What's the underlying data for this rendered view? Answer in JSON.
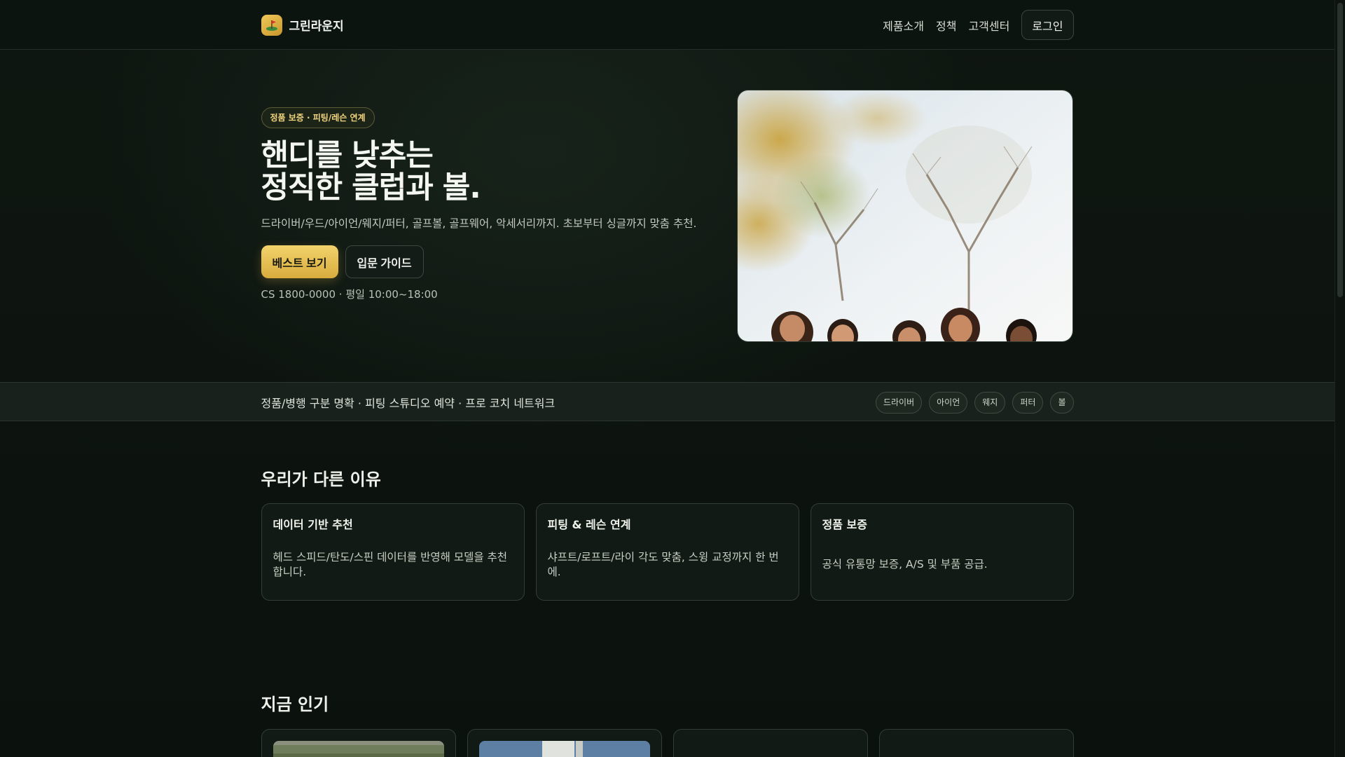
{
  "header": {
    "brand": "그린라운지",
    "nav": [
      "제품소개",
      "정책",
      "고객센터"
    ],
    "login": "로그인"
  },
  "hero": {
    "badge": "정품 보증 · 피팅/레슨 연계",
    "title_line1": "핸디를 낮추는",
    "title_line2": "정직한 클럽과 볼.",
    "description": "드라이버/우드/아이언/웨지/퍼터, 골프볼, 골프웨어, 악세서리까지. 초보부터 싱글까지 맞춤 추천.",
    "primary_cta": "베스트 보기",
    "secondary_cta": "입문 가이드",
    "cs": "CS 1800-0000 · 평일 10:00~18:00"
  },
  "strip": {
    "text": "정품/병행 구분 명확 · 피팅 스튜디오 예약 · 프로 코치 네트워크",
    "tags": [
      "드라이버",
      "아이언",
      "웨지",
      "퍼터",
      "볼"
    ]
  },
  "why": {
    "title": "우리가 다른 이유",
    "cards": [
      {
        "title": "데이터 기반 추천",
        "body": "헤드 스피드/탄도/스핀 데이터를 반영해 모델을 추천합니다."
      },
      {
        "title": "피팅 & 레슨 연계",
        "body": "샤프트/로프트/라이 각도 맞춤, 스윙 교정까지 한 번에."
      },
      {
        "title": "정품 보증",
        "body": "공식 유통망 보증, A/S 및 부품 공급."
      }
    ]
  },
  "popular": {
    "title": "지금 인기"
  },
  "colors": {
    "accent": "#f3d36d",
    "background": "#0c120e",
    "border": "#323e35"
  }
}
